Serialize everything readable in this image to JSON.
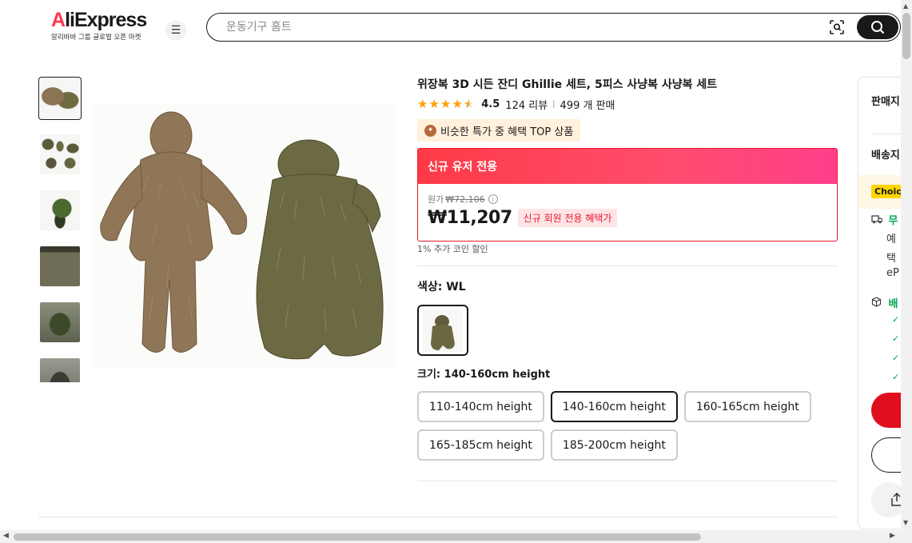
{
  "header": {
    "logo_text": "AliExpress",
    "logo_sub": "알리바바 그룹 글로벌 오픈 마켓",
    "menu_icon": "hamburger-icon",
    "search_placeholder": "운동기구 홈트",
    "camera_icon": "image-search-icon",
    "search_icon": "search-icon"
  },
  "gallery": {
    "thumbnails": [
      "thumbnail-1",
      "thumbnail-2",
      "thumbnail-3",
      "thumbnail-4",
      "thumbnail-5",
      "thumbnail-6"
    ],
    "active_index": 0
  },
  "product": {
    "title": "위장복 3D 시든 잔디 Ghillie 세트, 5피스 사냥복 사냥복 세트",
    "rating": "4.5",
    "rating_stars": 4.5,
    "reviews": "124 리뷰",
    "sold": "499 개 판매",
    "top_badge": "비슷한 특가 중 혜택 TOP 상품"
  },
  "promo": {
    "header": "신규 유저 전용",
    "original_label": "원가",
    "original_price": "₩72,106",
    "price": "₩11,207",
    "tag": "신규 회원 전용 혜택가",
    "coin_note": "1% 추가 코인 할인"
  },
  "options": {
    "color_label": "색상: WL",
    "size_label": "크기: 140-160cm height",
    "sizes": [
      "110-140cm height",
      "140-160cm height",
      "160-165cm height",
      "165-185cm height",
      "185-200cm height"
    ],
    "selected_size_index": 1
  },
  "side_panel": {
    "seller": "판매지",
    "ship_to": "배송지",
    "choice": "Choic",
    "free": "무",
    "lines": [
      "예",
      "택",
      "eP"
    ],
    "shipping2": "배",
    "icons": [
      "truck-icon",
      "box-icon"
    ]
  },
  "colors": {
    "brand_red": "#e00f1e",
    "promo_gradient_start": "#fe3a46",
    "promo_gradient_end": "#ff3f8a",
    "star": "#ff9f00",
    "green": "#00a650"
  }
}
